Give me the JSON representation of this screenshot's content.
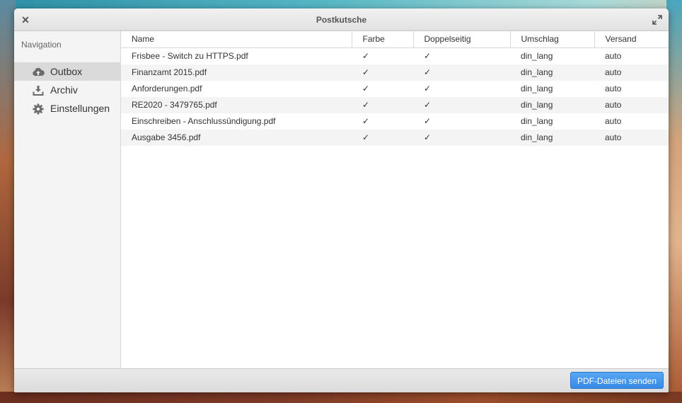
{
  "window": {
    "title": "Postkutsche"
  },
  "sidebar": {
    "header": "Navigation",
    "items": [
      {
        "label": "Outbox",
        "icon": "cloud-upload-icon",
        "active": true
      },
      {
        "label": "Archiv",
        "icon": "download-icon",
        "active": false
      },
      {
        "label": "Einstellungen",
        "icon": "gear-icon",
        "active": false
      }
    ]
  },
  "table": {
    "columns": [
      "Name",
      "Farbe",
      "Doppelseitig",
      "Umschlag",
      "Versand"
    ],
    "rows": [
      {
        "name": "Frisbee - Switch zu HTTPS.pdf",
        "farbe": "✓",
        "doppelseitig": "✓",
        "umschlag": "din_lang",
        "versand": "auto"
      },
      {
        "name": "Finanzamt 2015.pdf",
        "farbe": "✓",
        "doppelseitig": "✓",
        "umschlag": "din_lang",
        "versand": "auto"
      },
      {
        "name": "Anforderungen.pdf",
        "farbe": "✓",
        "doppelseitig": "✓",
        "umschlag": "din_lang",
        "versand": "auto"
      },
      {
        "name": "RE2020 - 3479765.pdf",
        "farbe": "✓",
        "doppelseitig": "✓",
        "umschlag": "din_lang",
        "versand": "auto"
      },
      {
        "name": "Einschreiben - Anschlussündigung.pdf",
        "farbe": "✓",
        "doppelseitig": "✓",
        "umschlag": "din_lang",
        "versand": "auto"
      },
      {
        "name": "Ausgabe 3456.pdf",
        "farbe": "✓",
        "doppelseitig": "✓",
        "umschlag": "din_lang",
        "versand": "auto"
      }
    ]
  },
  "footer": {
    "send_label": "PDF-Dateien senden"
  },
  "colors": {
    "accent": "#3689e6",
    "active_nav_bg": "#dadada",
    "alt_row_bg": "#f4f4f4"
  }
}
